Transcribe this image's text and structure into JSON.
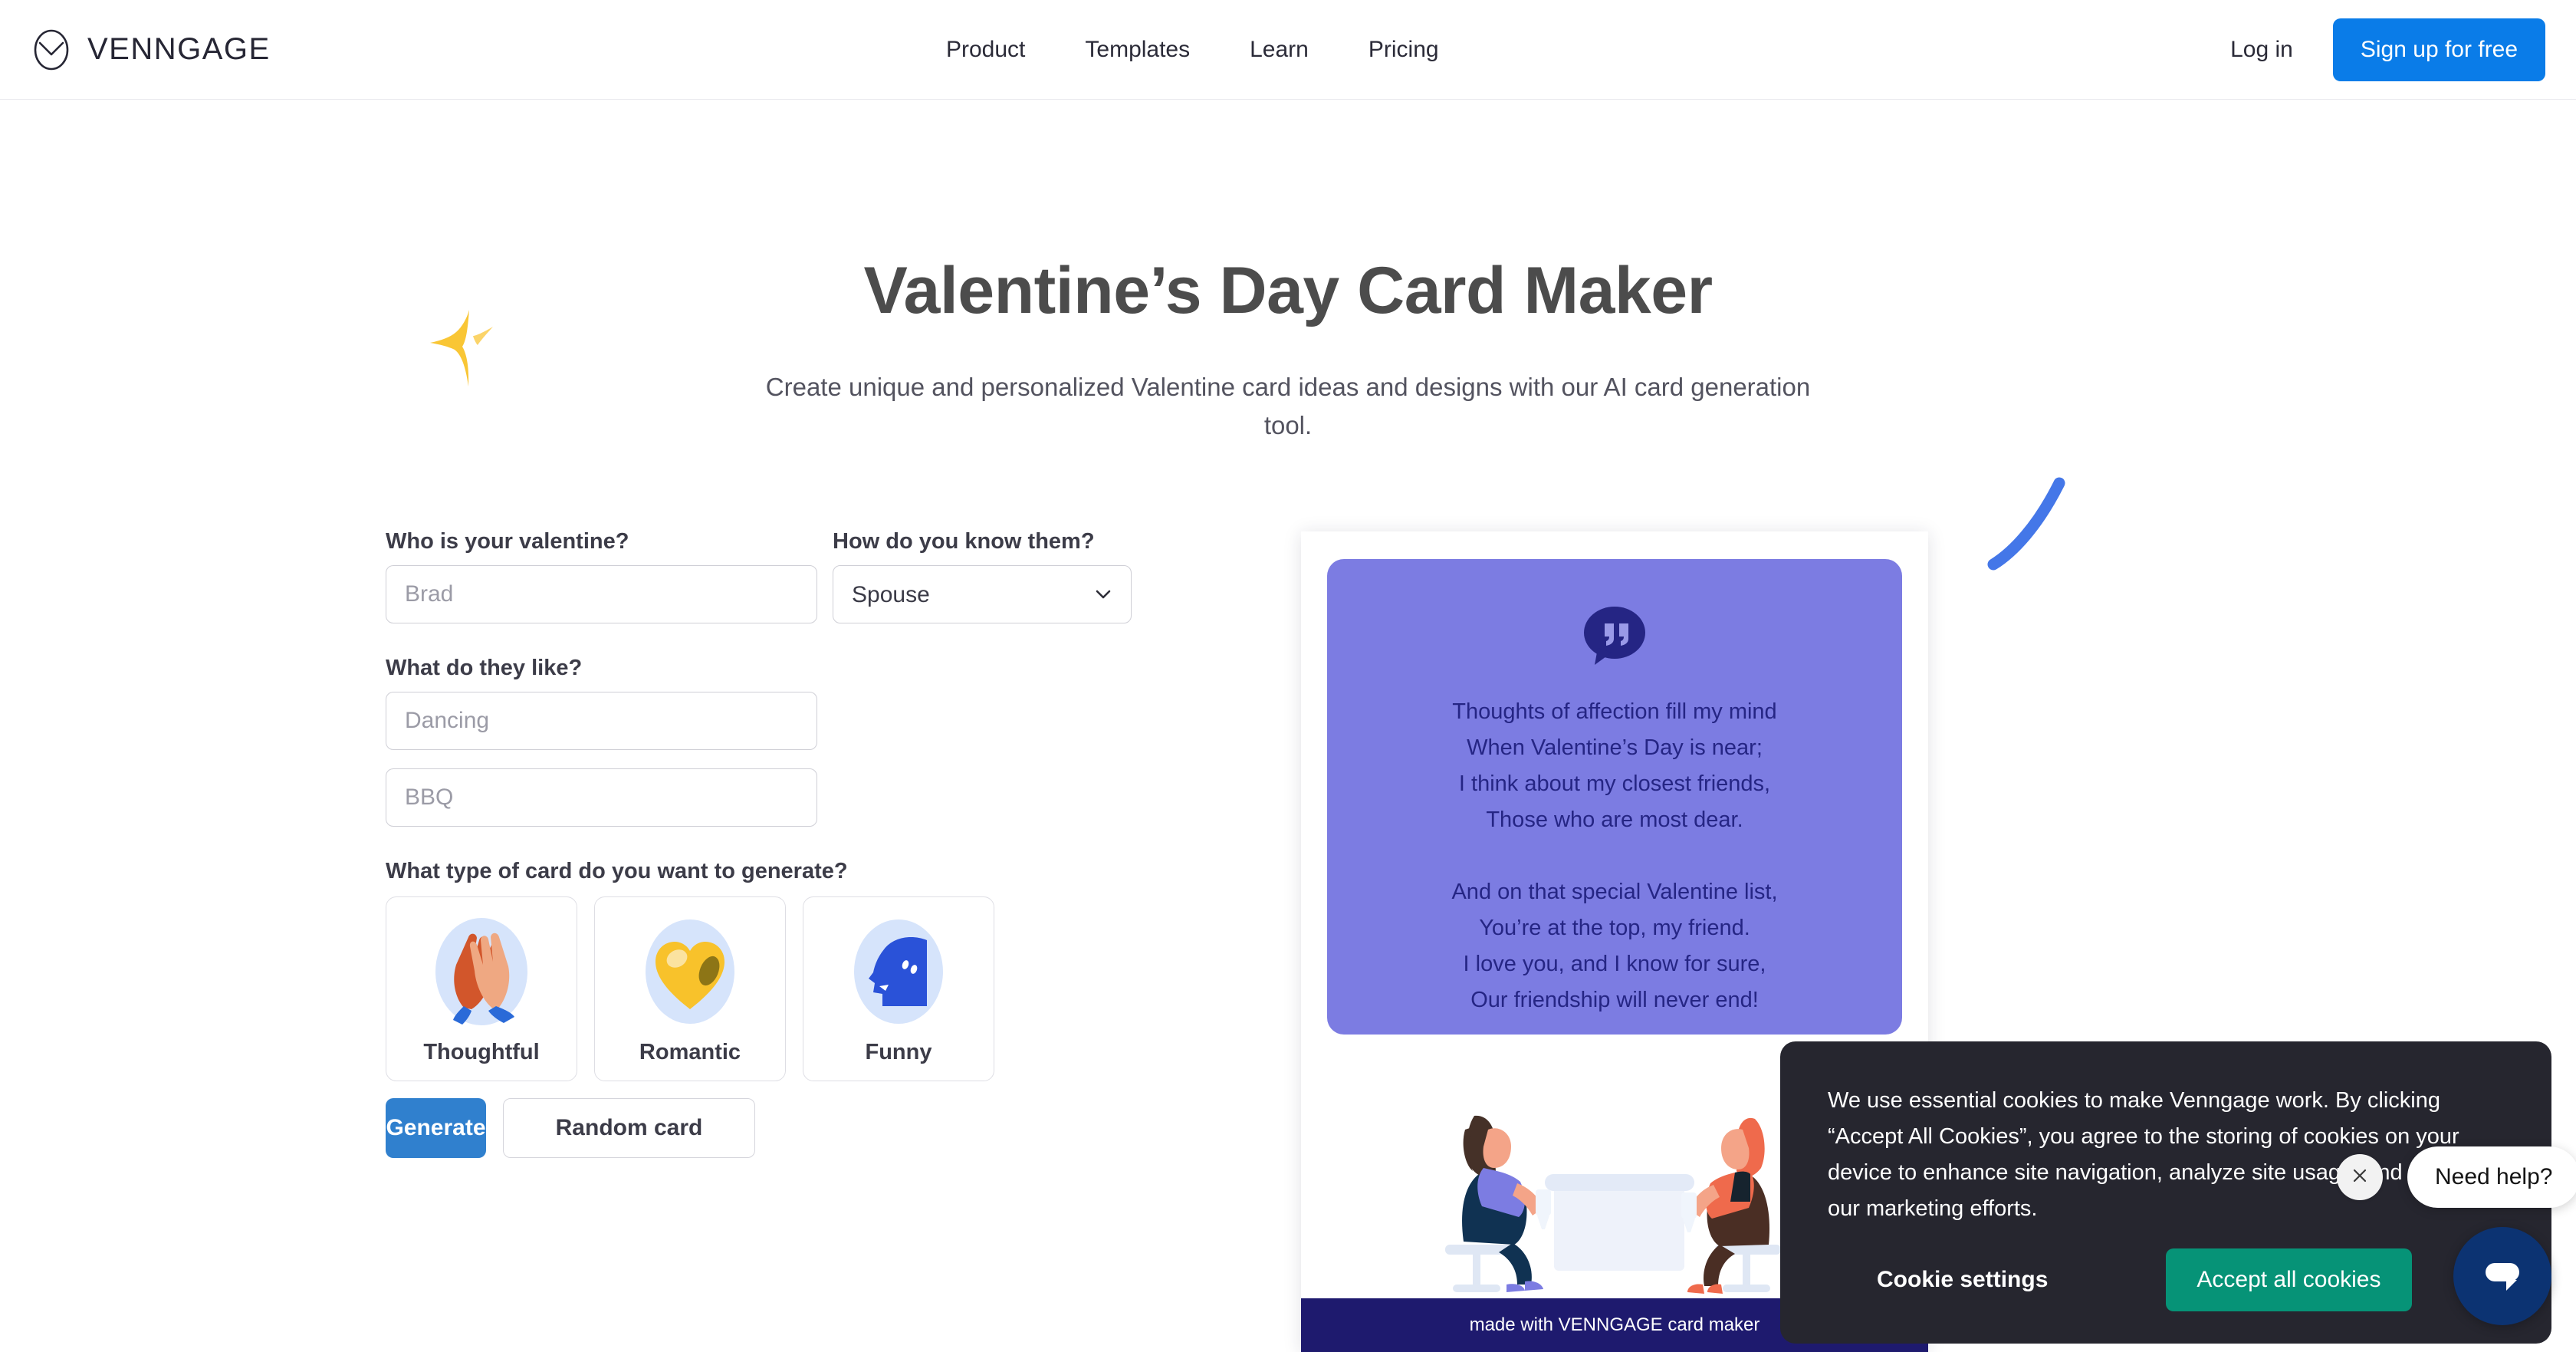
{
  "header": {
    "brand_name": "VENNGAGE",
    "brand_icon": "venngage-circle-logo",
    "nav": [
      {
        "label": "Product"
      },
      {
        "label": "Templates"
      },
      {
        "label": "Learn"
      },
      {
        "label": "Pricing"
      }
    ],
    "login_label": "Log in",
    "signup_label": "Sign up for free",
    "signup_color": "#0a7ce8"
  },
  "hero": {
    "title": "Valentine’s Day Card Maker",
    "subtitle": "Create unique and personalized Valentine card ideas and designs with our AI card generation tool.",
    "sparkle_icon": "sparkle-star-icon",
    "sparkle_color": "#f9c635",
    "squiggle_icon": "brush-stroke-icon",
    "squiggle_color": "#4477e8"
  },
  "form": {
    "valentine_label": "Who is your valentine?",
    "valentine_value": "",
    "valentine_placeholder": "Brad",
    "relation_label": "How do you know them?",
    "relation_value": "Spouse",
    "relation_options": [
      "Spouse"
    ],
    "likes_label": "What do they like?",
    "like1_value": "",
    "like1_placeholder": "Dancing",
    "like2_value": "",
    "like2_placeholder": "BBQ",
    "type_label": "What type of card do you want to generate?",
    "types": [
      {
        "label": "Thoughtful",
        "icon": "clapping-hands-icon"
      },
      {
        "label": "Romantic",
        "icon": "yellow-heart-icon"
      },
      {
        "label": "Funny",
        "icon": "speaking-head-icon"
      }
    ],
    "generate_label": "Generate",
    "generate_color": "#3080ce",
    "random_label": "Random card"
  },
  "preview": {
    "panel_color": "#7c7ce2",
    "quote_icon": "quote-bubble-icon",
    "poem": "Thoughts of affection fill my mind\nWhen Valentine’s Day is near;\nI think about my closest friends,\nThose who are most dear.\n\nAnd on that special Valentine list,\nYou’re at the top, my friend.\nI love you, and I know for sure,\nOur friendship will never end!",
    "illustration": "two-people-at-table-illustration",
    "footer_text": "made with VENNGAGE card maker",
    "footer_color": "#1e1a6e"
  },
  "cookies": {
    "message": "We use essential cookies to make Venngage work. By clicking “Accept All Cookies”, you agree to the storing of cookies on your device to enhance site navigation, analyze site usage, and assist in our marketing efforts.",
    "settings_label": "Cookie settings",
    "accept_label": "Accept all cookies",
    "accept_color": "#069377",
    "banner_color": "#26262f"
  },
  "widgets": {
    "close_icon": "close-x-icon",
    "need_help_label": "Need help?",
    "chat_icon": "chat-bubble-icon",
    "chat_color": "#0c3372"
  }
}
